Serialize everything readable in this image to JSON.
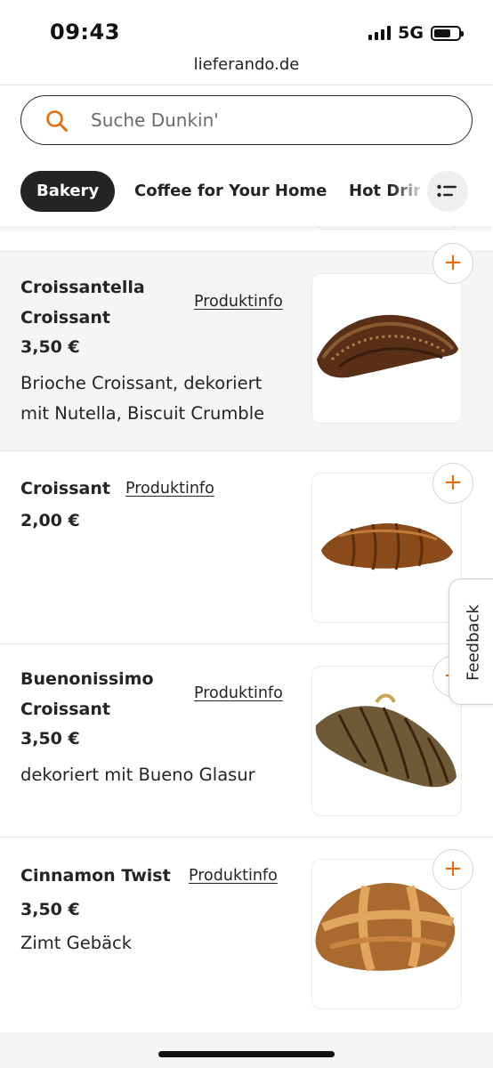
{
  "status_bar": {
    "time": "09:43",
    "network": "5G"
  },
  "browser": {
    "url": "lieferando.de"
  },
  "search": {
    "placeholder": "Suche Dunkin'",
    "value": ""
  },
  "categories": {
    "items": [
      "Bakery",
      "Coffee for Your Home",
      "Hot Drin"
    ],
    "active": "Bakery"
  },
  "menu_items": [
    {
      "name_line1": "Croissantella",
      "name_line2": "Croissant",
      "info": "Produktinfo",
      "price": "3,50 €",
      "desc_line1": "Brioche Croissant, dekoriert",
      "desc_line2": "mit Nutella, Biscuit Crumble",
      "add": "+"
    },
    {
      "name_line1": "Croissant",
      "info": "Produktinfo",
      "price": "2,00 €",
      "add": "+"
    },
    {
      "name_line1": "Buenonissimo",
      "name_line2": "Croissant",
      "info": "Produktinfo",
      "price": "3,50 €",
      "desc_line1": "dekoriert mit Bueno Glasur",
      "add": "+"
    },
    {
      "name_line1": "Cinnamon Twist",
      "info": "Produktinfo",
      "price": "3,50 €",
      "desc_line1": "Zimt Gebäck",
      "add": "+"
    }
  ],
  "feedback": {
    "label": "Feedback"
  },
  "colors": {
    "accent": "#e46c0a",
    "dark": "#242424",
    "shaded_row": "#f5f5f5"
  },
  "icons": {
    "search": "search-icon",
    "filter": "list-filter-icon",
    "add": "plus-icon"
  }
}
